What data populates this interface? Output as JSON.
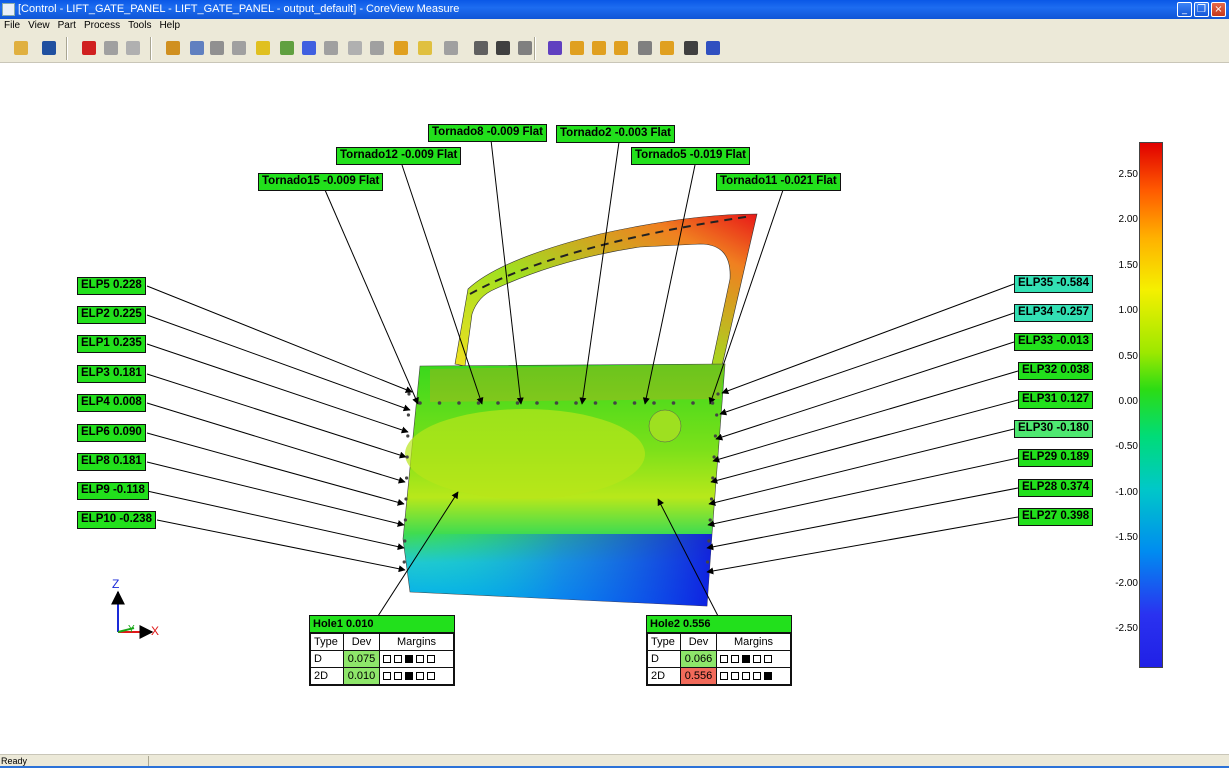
{
  "window": {
    "title": "[Control - LIFT_GATE_PANEL - LIFT_GATE_PANEL - output_default] - CoreView Measure"
  },
  "menu": [
    "File",
    "View",
    "Part",
    "Process",
    "Tools",
    "Help"
  ],
  "toolbar_icons": [
    "open-icon",
    "save-icon",
    "color-points-icon",
    "grid-icon",
    "grid-gray-icon",
    "probe-icon",
    "feature-icon",
    "mesh-icon",
    "mesh2-icon",
    "cube-icon",
    "flag-icon",
    "colormap-icon",
    "analyze-icon",
    "section-icon",
    "section2-icon",
    "path-icon",
    "plane-icon",
    "point-icon",
    "vector-icon",
    "select-icon",
    "erase-icon",
    "label-icon",
    "flag2-icon",
    "flag3-icon",
    "flag4-icon",
    "measure-icon",
    "edit-label-icon",
    "align-icon",
    "properties-icon"
  ],
  "tornado_labels": [
    {
      "text": "Tornado8 -0.009 Flat"
    },
    {
      "text": "Tornado2 -0.003 Flat"
    },
    {
      "text": "Tornado12 -0.009 Flat"
    },
    {
      "text": "Tornado5 -0.019 Flat"
    },
    {
      "text": "Tornado15 -0.009 Flat"
    },
    {
      "text": "Tornado11 -0.021 Flat"
    }
  ],
  "left_labels": [
    "ELP5 0.228",
    "ELP2 0.225",
    "ELP1 0.235",
    "ELP3 0.181",
    "ELP4 0.008",
    "ELP6 0.090",
    "ELP8 0.181",
    "ELP9 -0.118",
    "ELP10 -0.238"
  ],
  "right_labels": [
    "ELP35 -0.584",
    "ELP34 -0.257",
    "ELP33 -0.013",
    "ELP32 0.038",
    "ELP31 0.127",
    "ELP30 -0.180",
    "ELP29 0.189",
    "ELP28 0.374",
    "ELP27 0.398"
  ],
  "holes": [
    {
      "title": "Hole1 0.010",
      "headers": [
        "Type",
        "Dev",
        "Margins"
      ],
      "rows": [
        {
          "type": "D",
          "dev": "0.075",
          "dev_state": "ok",
          "margins": [
            0,
            0,
            1,
            0,
            0
          ]
        },
        {
          "type": "2D",
          "dev": "0.010",
          "dev_state": "ok",
          "margins": [
            0,
            0,
            1,
            0,
            0
          ]
        }
      ]
    },
    {
      "title": "Hole2 0.556",
      "headers": [
        "Type",
        "Dev",
        "Margins"
      ],
      "rows": [
        {
          "type": "D",
          "dev": "0.066",
          "dev_state": "ok",
          "margins": [
            0,
            0,
            1,
            0,
            0
          ]
        },
        {
          "type": "2D",
          "dev": "0.556",
          "dev_state": "bad",
          "margins": [
            0,
            0,
            0,
            0,
            1
          ]
        }
      ]
    }
  ],
  "colorbar": {
    "ticks": [
      "2.50",
      "2.00",
      "1.50",
      "1.00",
      "0.50",
      "0.00",
      "-0.50",
      "-1.00",
      "-1.50",
      "-2.00",
      "-2.50"
    ]
  },
  "axes": {
    "z": "Z",
    "y": "Y",
    "x": "X"
  },
  "status": {
    "text": "Ready"
  },
  "colors": {
    "label_green": "#22e01c",
    "label_cyan": "#33e0b4",
    "dev_bad": "#f26a5a",
    "dev_ok": "#8ee66a"
  }
}
